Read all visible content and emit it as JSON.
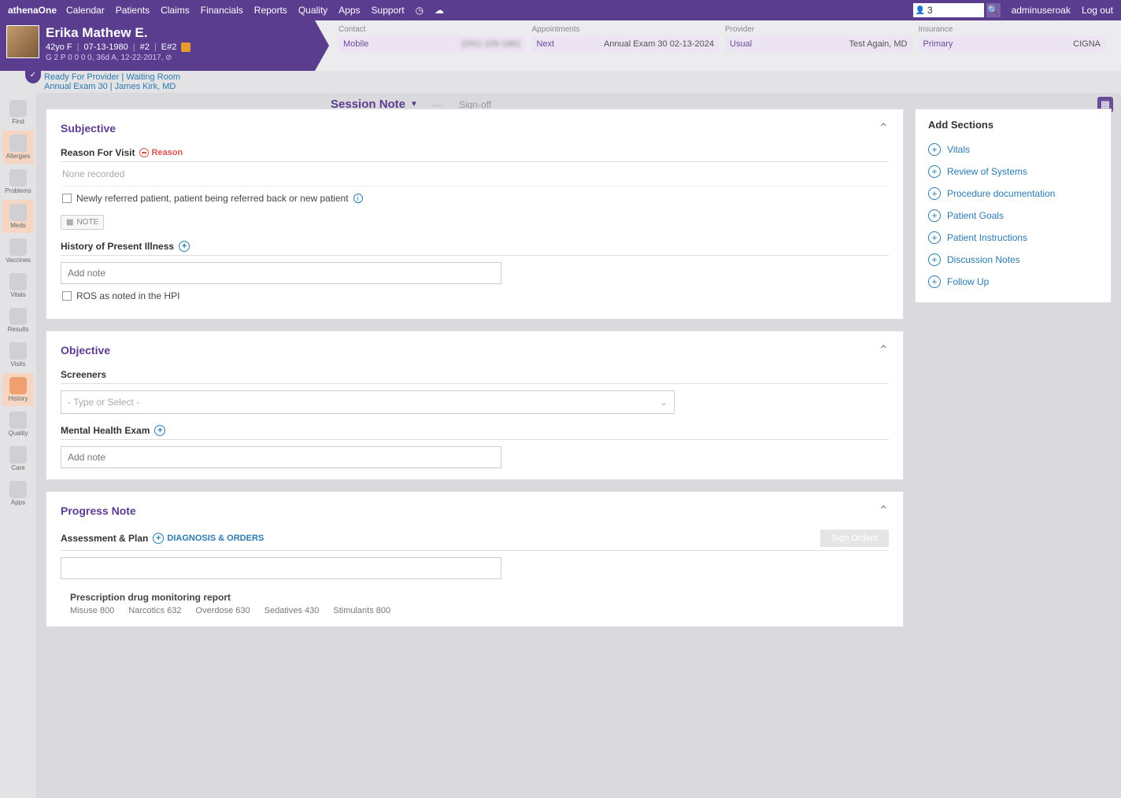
{
  "topnav": {
    "brand": "athenaOne",
    "items": [
      "Calendar",
      "Patients",
      "Claims",
      "Financials",
      "Reports",
      "Quality",
      "Apps",
      "Support"
    ],
    "search_value": "3",
    "user": "adminuseroak",
    "logout": "Log out"
  },
  "patient": {
    "name": "Erika Mathew E.",
    "meta": [
      "42yo F",
      "07-13-1980",
      "#2",
      "E#2"
    ],
    "line2": "G 2 P 0 0 0 0, 36d A, 12-22-2017, ⊘"
  },
  "info": {
    "contact": {
      "label": "Contact",
      "key": "Mobile",
      "value": "(091) 109-1881"
    },
    "appointments": {
      "label": "Appointments",
      "key": "Next",
      "value": "Annual Exam 30 02-13-2024"
    },
    "provider": {
      "label": "Provider",
      "key": "Usual",
      "value": "Test Again, MD"
    },
    "insurance": {
      "label": "Insurance",
      "key": "Primary",
      "value": "CIGNA"
    }
  },
  "status": {
    "line1": "Ready For Provider | Waiting Room",
    "line2": "Annual Exam 30 | James Kirk, MD"
  },
  "session": {
    "title": "Session Note",
    "signoff": "Sign-off"
  },
  "rail": [
    {
      "label": "Find"
    },
    {
      "label": "Allergies"
    },
    {
      "label": "Problems"
    },
    {
      "label": "Meds"
    },
    {
      "label": "Vaccines"
    },
    {
      "label": "Vitals"
    },
    {
      "label": "Results"
    },
    {
      "label": "Visits"
    },
    {
      "label": "History"
    },
    {
      "label": "Quality"
    },
    {
      "label": "Care"
    },
    {
      "label": "Apps"
    }
  ],
  "subjective": {
    "title": "Subjective",
    "rfv_title": "Reason For Visit",
    "rfv_tag": "Reason",
    "none": "None recorded",
    "chk_text": "Newly referred patient, patient being referred back or new patient",
    "note_btn": "NOTE",
    "hpi_title": "History of Present Illness",
    "hpi_placeholder": "Add note",
    "ros_chk": "ROS as noted in the HPI"
  },
  "objective": {
    "title": "Objective",
    "screeners_title": "Screeners",
    "screeners_placeholder": "- Type or Select -",
    "mhe_title": "Mental Health Exam",
    "mhe_placeholder": "Add note"
  },
  "progress": {
    "title": "Progress Note",
    "ap_title": "Assessment & Plan",
    "diag_link": "DIAGNOSIS & ORDERS",
    "sign_orders": "Sign Orders",
    "pdmp_title": "Prescription drug monitoring report",
    "pdmp_items": [
      "Misuse 800",
      "Narcotics 632",
      "Overdose 630",
      "Sedatives 430",
      "Stimulants 800"
    ]
  },
  "add_sections": {
    "title": "Add Sections",
    "items": [
      "Vitals",
      "Review of Systems",
      "Procedure documentation",
      "Patient Goals",
      "Patient Instructions",
      "Discussion Notes",
      "Follow Up"
    ]
  }
}
